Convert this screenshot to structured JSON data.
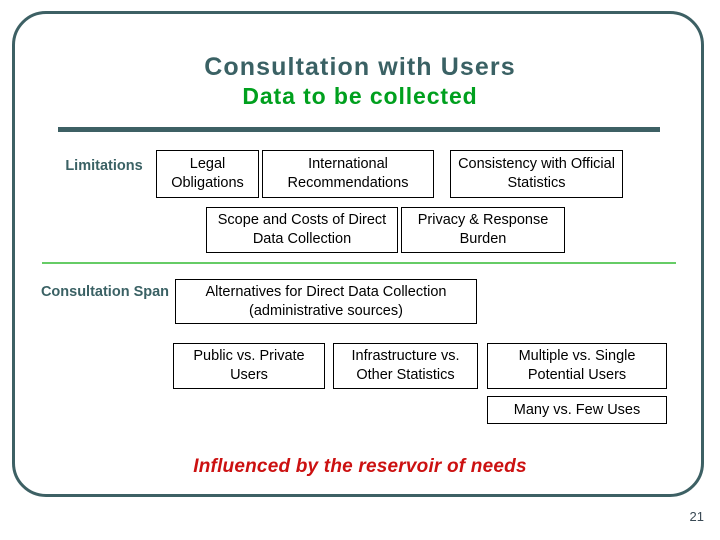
{
  "slide": {
    "title_main": "Consultation with Users",
    "title_sub": "Data to be collected",
    "footer_note": "Influenced by the reservoir of needs",
    "page_number": "21",
    "colors": {
      "frame": "#3d6064",
      "title_main": "#3a6164",
      "title_sub": "#00a01e",
      "divider_main": "#3d6064",
      "divider_green": "#66cc66",
      "footer_note": "#cc1111",
      "box_border": "#000000"
    }
  },
  "sections": {
    "limitations": {
      "label": "Limitations",
      "row1": [
        {
          "text": "Legal Obligations"
        },
        {
          "text": "International Recommendations"
        },
        {
          "text": "Consistency with Official Statistics"
        }
      ],
      "row2": [
        {
          "text": "Scope and Costs of Direct Data Collection"
        },
        {
          "text": "Privacy & Response Burden"
        }
      ]
    },
    "consultation_span": {
      "label": "Consultation Span",
      "row1": [
        {
          "text": "Alternatives for Direct Data Collection (administrative sources)"
        }
      ],
      "row2": [
        {
          "text": "Public vs. Private Users"
        },
        {
          "text": "Infrastructure vs. Other Statistics"
        },
        {
          "text": "Multiple vs. Single Potential Users"
        }
      ],
      "row3": [
        {
          "text": "Many vs. Few Uses"
        }
      ]
    }
  }
}
